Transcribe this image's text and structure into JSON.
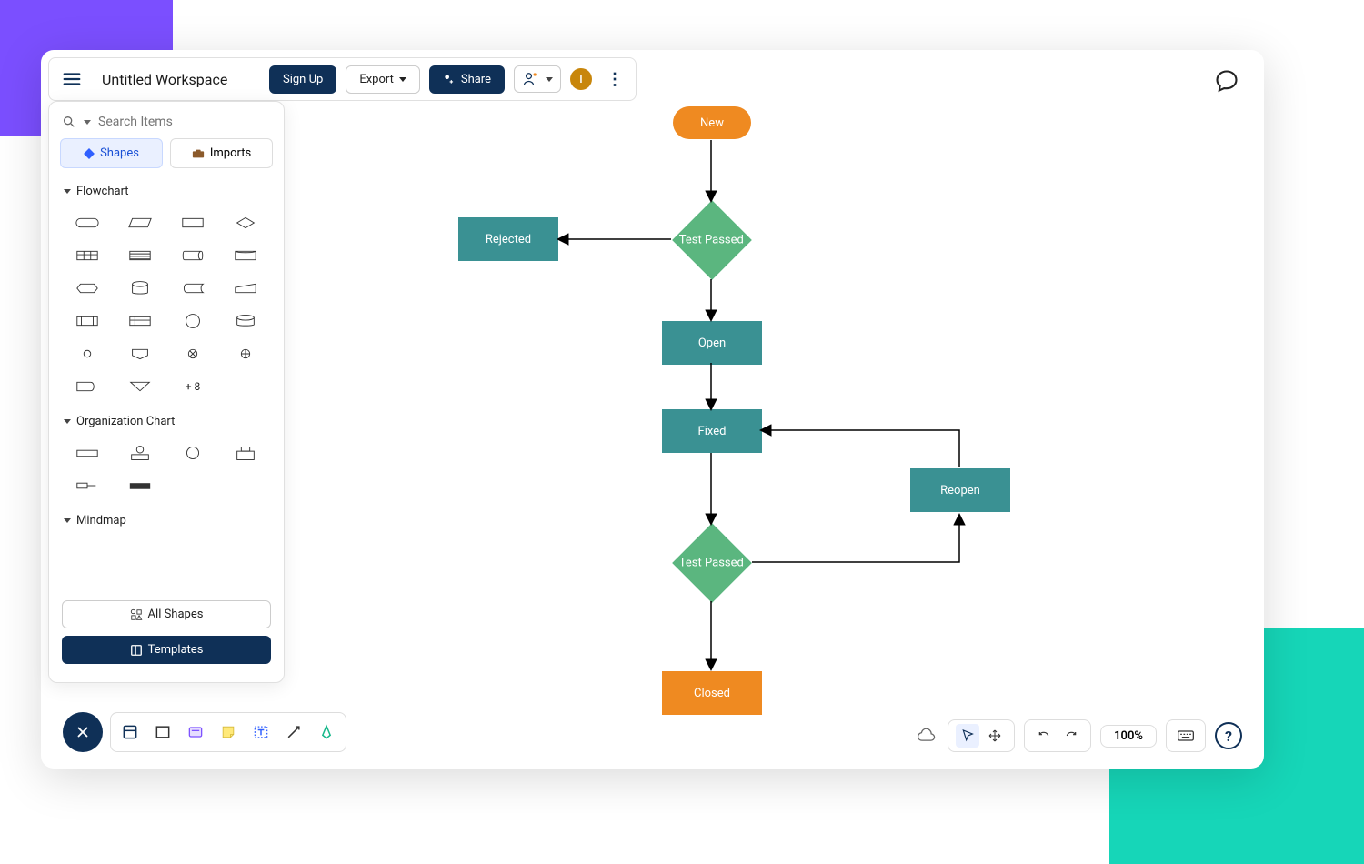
{
  "colors": {
    "purple": "#7B4FFF",
    "teal_bg": "#16D6B8",
    "navy": "#0F3057",
    "orange": "#EF8A21",
    "teal_node": "#3A9193",
    "green_node": "#5BB67F"
  },
  "header": {
    "title": "Untitled Workspace",
    "signup": "Sign Up",
    "export": "Export",
    "share": "Share",
    "avatar_initial": "I"
  },
  "sidebar": {
    "search_placeholder": "Search Items",
    "tabs": {
      "shapes": "Shapes",
      "imports": "Imports"
    },
    "sections": {
      "flowchart": "Flowchart",
      "org": "Organization Chart",
      "mindmap": "Mindmap"
    },
    "more": "+ 8",
    "all_shapes": "All Shapes",
    "templates": "Templates"
  },
  "diagram": {
    "nodes": {
      "new": "New",
      "test1": "Test Passed",
      "rejected": "Rejected",
      "open": "Open",
      "fixed": "Fixed",
      "test2": "Test Passed",
      "reopen": "Reopen",
      "closed": "Closed"
    }
  },
  "footer": {
    "zoom": "100%",
    "help": "?"
  }
}
